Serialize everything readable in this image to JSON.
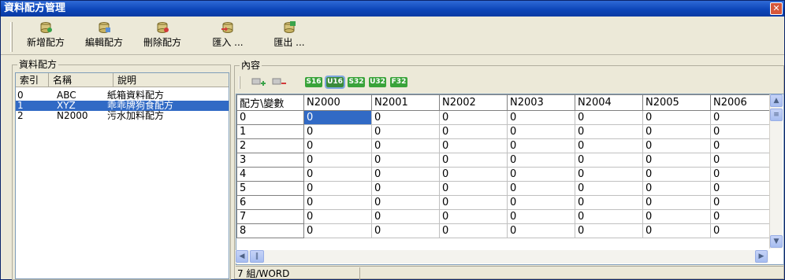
{
  "window": {
    "title": "資料配方管理",
    "close": "✕"
  },
  "toolbar": {
    "new_label": "新增配方",
    "edit_label": "編輯配方",
    "delete_label": "刪除配方",
    "import_label": "匯入 ...",
    "export_label": "匯出 ..."
  },
  "recipes_panel": {
    "title": "資料配方",
    "columns": [
      "索引",
      "名稱",
      "說明"
    ],
    "rows": [
      {
        "index": "0",
        "name": "ABC",
        "desc": "紙箱資料配方"
      },
      {
        "index": "1",
        "name": "XYZ",
        "desc": "乖乖牌狗食配方"
      },
      {
        "index": "2",
        "name": "N2000",
        "desc": "污水加料配方"
      }
    ],
    "selected_index": 1
  },
  "content_panel": {
    "title": "內容",
    "formats": [
      "S16",
      "U16",
      "S32",
      "U32",
      "F32"
    ],
    "active_format": "U16",
    "format_colors": {
      "active": "#3a8a3a",
      "normal": "#39a33a"
    }
  },
  "grid": {
    "corner": "配方\\變數",
    "columns": [
      "N2000",
      "N2001",
      "N2002",
      "N2003",
      "N2004",
      "N2005",
      "N2006"
    ],
    "rows": [
      {
        "label": "0",
        "values": [
          "0",
          "0",
          "0",
          "0",
          "0",
          "0",
          "0"
        ]
      },
      {
        "label": "1",
        "values": [
          "0",
          "0",
          "0",
          "0",
          "0",
          "0",
          "0"
        ]
      },
      {
        "label": "2",
        "values": [
          "0",
          "0",
          "0",
          "0",
          "0",
          "0",
          "0"
        ]
      },
      {
        "label": "3",
        "values": [
          "0",
          "0",
          "0",
          "0",
          "0",
          "0",
          "0"
        ]
      },
      {
        "label": "4",
        "values": [
          "0",
          "0",
          "0",
          "0",
          "0",
          "0",
          "0"
        ]
      },
      {
        "label": "5",
        "values": [
          "0",
          "0",
          "0",
          "0",
          "0",
          "0",
          "0"
        ]
      },
      {
        "label": "6",
        "values": [
          "0",
          "0",
          "0",
          "0",
          "0",
          "0",
          "0"
        ]
      },
      {
        "label": "7",
        "values": [
          "0",
          "0",
          "0",
          "0",
          "0",
          "0",
          "0"
        ]
      },
      {
        "label": "8",
        "values": [
          "0",
          "0",
          "0",
          "0",
          "0",
          "0",
          "0"
        ]
      }
    ]
  },
  "status": {
    "text": "7 組/WORD"
  },
  "colors": {
    "selection": "#316ac5",
    "title_bar": "#0d46b9"
  }
}
